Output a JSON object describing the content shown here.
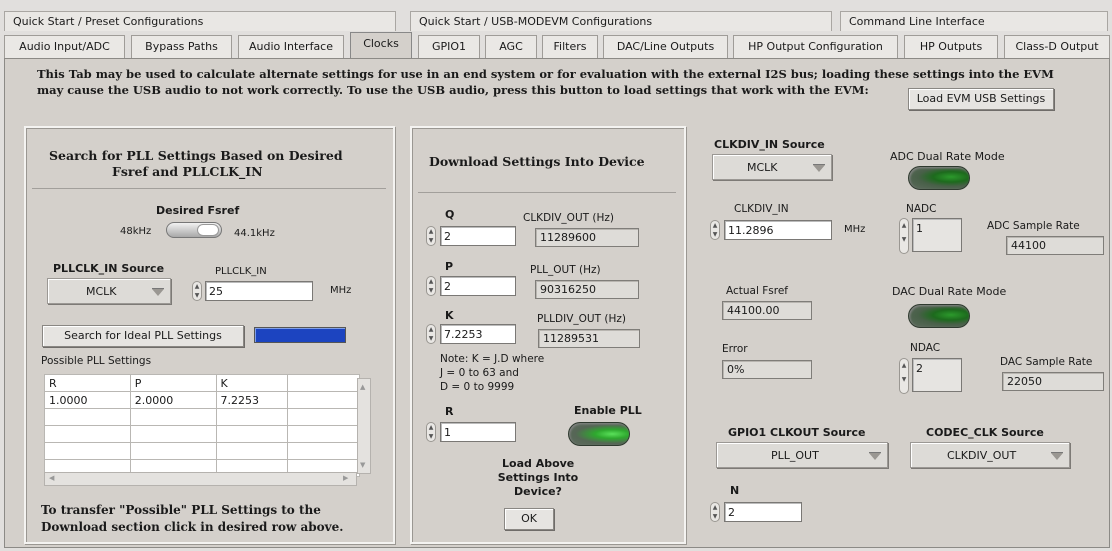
{
  "top_tabs": [
    "Quick Start / Preset Configurations",
    "Quick Start / USB-MODEVM Configurations",
    "Command Line Interface"
  ],
  "tabs": [
    "Audio Input/ADC",
    "Bypass Paths",
    "Audio Interface",
    "Clocks",
    "GPIO1",
    "AGC",
    "Filters",
    "DAC/Line Outputs",
    "HP Output Configuration",
    "HP Outputs",
    "Class-D Output"
  ],
  "notice": {
    "line1": "This Tab may be used to calculate alternate settings for use in an end system or for evaluation with the external I2S bus;  loading these settings into the EVM",
    "line2": "may cause  the USB audio to not work correctly.  To use the USB audio, press this button to load settings that work with the EVM:",
    "load_button": "Load EVM USB Settings"
  },
  "search_panel": {
    "title_line1": "Search for PLL Settings Based on Desired",
    "title_line2": "Fsref and PLLCLK_IN",
    "fsref_label": "Desired Fsref",
    "fsref_left": "48kHz",
    "fsref_right": "44.1kHz",
    "source_label": "PLLCLK_IN Source",
    "source_value": "MCLK",
    "pllclk_label": "PLLCLK_IN",
    "pllclk_value": "25",
    "pllclk_unit": "MHz",
    "search_button": "Search for Ideal PLL Settings",
    "possible_label": "Possible PLL Settings",
    "table_headers": [
      "R",
      "P",
      "K",
      ""
    ],
    "table_rows": [
      [
        "1.0000",
        "2.0000",
        "7.2253",
        ""
      ],
      [
        "",
        "",
        "",
        ""
      ],
      [
        "",
        "",
        "",
        ""
      ],
      [
        "",
        "",
        "",
        ""
      ],
      [
        "",
        "",
        "",
        ""
      ]
    ],
    "footer_line1": "To transfer \"Possible\" PLL Settings to the",
    "footer_line2": "Download section click in desired row above."
  },
  "download_panel": {
    "title": "Download Settings Into Device",
    "q_label": "Q",
    "q_value": "2",
    "clkdiv_out_label": "CLKDIV_OUT (Hz)",
    "clkdiv_out_value": "11289600",
    "p_label": "P",
    "p_value": "2",
    "pll_out_label": "PLL_OUT (Hz)",
    "pll_out_value": "90316250",
    "k_label": "K",
    "k_value": "7.2253",
    "plldiv_out_label": "PLLDIV_OUT (Hz)",
    "plldiv_out_value": "11289531",
    "note_line1": "Note: K = J.D where",
    "note_line2": "J = 0 to 63 and",
    "note_line3": "D = 0 to 9999",
    "r_label": "R",
    "r_value": "1",
    "enable_pll_label": "Enable PLL",
    "load_q_line1": "Load Above",
    "load_q_line2": "Settings Into",
    "load_q_line3": "Device?",
    "ok_button": "OK"
  },
  "clock_panel": {
    "clkdiv_in_source_label": "CLKDIV_IN Source",
    "clkdiv_in_source_value": "MCLK",
    "adc_dual_label": "ADC Dual Rate Mode",
    "clkdiv_in_label": "CLKDIV_IN",
    "clkdiv_in_value": "11.2896",
    "clkdiv_in_unit": "MHz",
    "nadc_label": "NADC",
    "nadc_value": "1",
    "adc_rate_label": "ADC Sample Rate",
    "adc_rate_value": "44100",
    "actual_fsref_label": "Actual Fsref",
    "actual_fsref_value": "44100.00",
    "dac_dual_label": "DAC Dual Rate Mode",
    "error_label": "Error",
    "error_value": "0%",
    "ndac_label": "NDAC",
    "ndac_value": "2",
    "dac_rate_label": "DAC Sample Rate",
    "dac_rate_value": "22050",
    "gpio1_label": "GPIO1 CLKOUT Source",
    "gpio1_value": "PLL_OUT",
    "codec_label": "CODEC_CLK Source",
    "codec_value": "CLKDIV_OUT",
    "n_label": "N",
    "n_value": "2"
  }
}
